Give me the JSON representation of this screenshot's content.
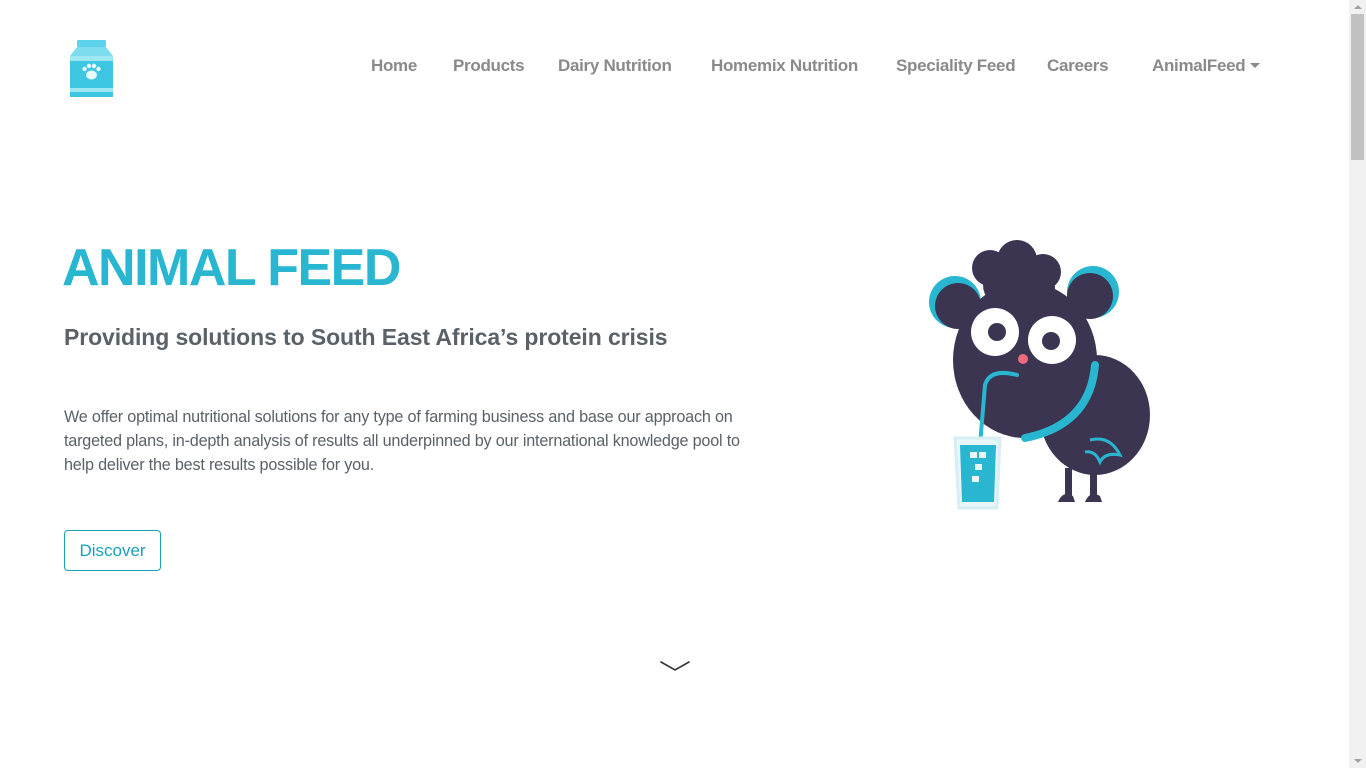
{
  "brand": {
    "logo_icon": "milk-carton-paw-icon",
    "accent_color": "#29b6d1",
    "button_color": "#17a2b8"
  },
  "nav": {
    "home": "Home",
    "products": "Products",
    "dairy": "Dairy Nutrition",
    "homemix": "Homemix Nutrition",
    "speciality": "Speciality Feed",
    "careers": "Careers",
    "dropdown": "AnimalFeed"
  },
  "hero": {
    "title": "ANIMAL FEED",
    "subtitle": "Providing solutions to South East Africa’s protein crisis",
    "text": "We offer optimal nutritional solutions for any type of farming business and base our approach on targeted plans, in-depth analysis of results all underpinned by our international knowledge pool to help deliver the best results possible for you.",
    "button_label": "Discover",
    "illustration": "sheep-drinking-icon"
  },
  "scroll": {
    "indicator_icon": "chevron-down-icon"
  }
}
